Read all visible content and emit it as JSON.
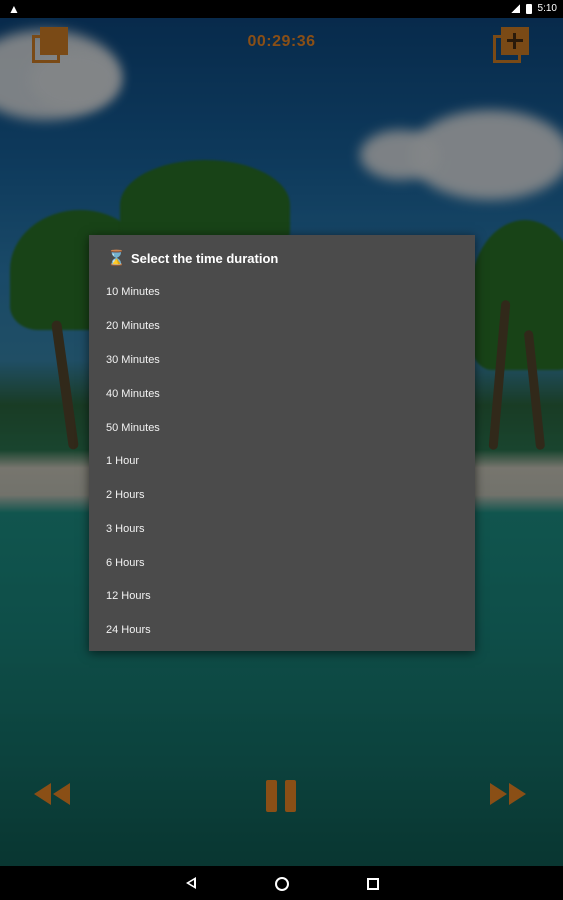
{
  "status_bar": {
    "time": "5:10"
  },
  "toolbar": {
    "timer": "00:29:36"
  },
  "dialog": {
    "title": "Select the time duration",
    "options": [
      "10 Minutes",
      "20 Minutes",
      "30 Minutes",
      "40 Minutes",
      "50 Minutes",
      "1 Hour",
      "2 Hours",
      "3 Hours",
      "6 Hours",
      "12 Hours",
      "24 Hours"
    ]
  },
  "colors": {
    "accent": "#8a4f16",
    "dialog_bg": "#4b4b4b"
  },
  "icons": {
    "status_warning": "warning-icon",
    "edit": "edit-copy-icon",
    "add": "add-to-playlist-icon",
    "hourglass": "hourglass-icon",
    "rewind": "rewind-icon",
    "pause": "pause-icon",
    "fast_forward": "fast-forward-icon",
    "nav_back": "nav-back-icon",
    "nav_home": "nav-home-icon",
    "nav_recent": "nav-recent-icon"
  }
}
